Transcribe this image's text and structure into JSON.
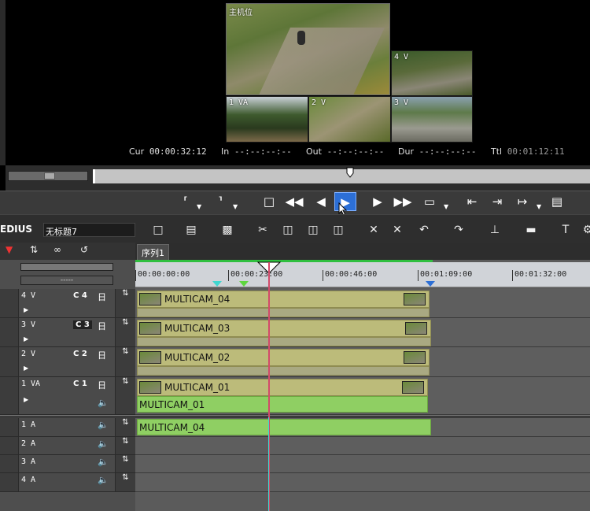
{
  "player": {
    "main_label": "主机位",
    "cams": [
      {
        "label": "1 VA"
      },
      {
        "label": "2 V"
      },
      {
        "label": "3 V"
      },
      {
        "label": "4 V"
      }
    ],
    "timecodes": {
      "cur_label": "Cur",
      "cur_value": "00:00:32:12",
      "in_label": "In",
      "in_value": "--:--:--:--",
      "out_label": "Out",
      "out_value": "--:--:--:--",
      "dur_label": "Dur",
      "dur_value": "--:--:--:--",
      "ttl_label": "Ttl",
      "ttl_value": "00:01:12:11"
    }
  },
  "toolbar": {
    "app_name": "EDIUS",
    "project_name": "无标题7"
  },
  "timeline": {
    "sequence_tab": "序列1",
    "ruler_labels": [
      "00:00:00:00",
      "00:00:23:00",
      "00:00:46:00",
      "00:01:09:00",
      "00:01:32:00"
    ],
    "header_select": "-----",
    "video_tracks": [
      {
        "name": "4 V",
        "channel": "C 4",
        "clip": "MULTICAM_04"
      },
      {
        "name": "3 V",
        "channel": "C 3",
        "clip": "MULTICAM_03"
      },
      {
        "name": "2 V",
        "channel": "C 2",
        "clip": "MULTICAM_02"
      },
      {
        "name": "1 VA",
        "channel": "C 1",
        "clip": "MULTICAM_01",
        "audio_clip": "MULTICAM_01"
      }
    ],
    "audio_tracks": [
      {
        "name": "1 A",
        "clip": "MULTICAM_04"
      },
      {
        "name": "2 A"
      },
      {
        "name": "3 A"
      },
      {
        "name": "4 A"
      }
    ]
  },
  "colors": {
    "play_button": "#2c6fd6",
    "video_clip": "#bcbb7a",
    "audio_clip": "#8fcf63",
    "cursor": "#d34a6a"
  }
}
